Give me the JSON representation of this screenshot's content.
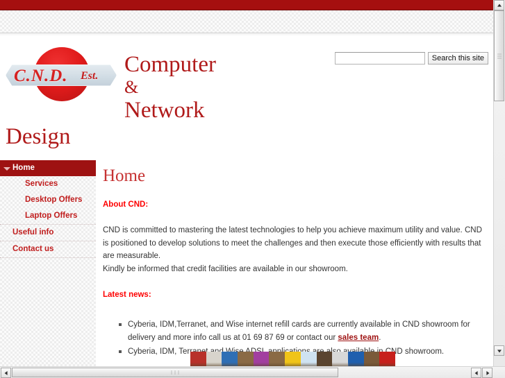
{
  "browser": {
    "vertical_scrollbar": {
      "up_arrow": "▲",
      "down_arrow": "▼"
    },
    "horizontal_scrollbar": {
      "left_arrow": "◄",
      "right_arrow": "►"
    }
  },
  "header": {
    "logo": {
      "badge_text": "C.N.D.",
      "badge_suffix": "Est.",
      "circle_color": "#e01b1b",
      "plate_color": "#d2dde5"
    },
    "wordmark": {
      "line1": "Computer",
      "line2": "&",
      "line3": "Network",
      "line4": "Design",
      "color": "#b01a1a"
    },
    "search": {
      "value": "",
      "placeholder": "",
      "button_label": "Search this site"
    }
  },
  "sidebar": {
    "items": [
      {
        "label": "Home",
        "level": "top",
        "active": true,
        "caret": "chevron-down-icon"
      },
      {
        "label": "Services",
        "level": "sub",
        "active": false
      },
      {
        "label": "Desktop Offers",
        "level": "sub",
        "active": false
      },
      {
        "label": "Laptop Offers",
        "level": "sub",
        "active": false
      },
      {
        "label": "Useful info",
        "level": "plain",
        "active": false
      },
      {
        "label": "Contact us",
        "level": "plain",
        "active": false
      }
    ],
    "active_color": "#9e1212",
    "link_color": "#c01d1d"
  },
  "main": {
    "title": "Home",
    "about_heading": "About CND:",
    "about_paragraph": "CND is committed to mastering the latest technologies to help you achieve maximum utility and value. CND is positioned to develop solutions to meet the challenges and then execute those efficiently with results that are measurable.\nKindly be informed that credit facilities are available in our showroom.",
    "about_line1": "CND is committed to mastering the latest technologies to help you achieve maximum utility and value.",
    "about_line2": "CND is positioned to develop solutions to meet the challenges and then execute those efficiently with results that are measurable.",
    "about_line3": "Kindly be informed that credit facilities are available in our showroom.",
    "news_heading": "Latest news:",
    "news_items": [
      {
        "text_before": "Cyberia, IDM,Terranet, and Wise internet refill cards are currently available in CND showroom for delivery and more info call us at 01 69 87 69 or contact our ",
        "link_label": "sales team",
        "text_after": "."
      },
      {
        "text_before": "Cyberia, IDM, Terranet and Wise ADSL applications are also available in CND showroom.",
        "link_label": "",
        "text_after": ""
      }
    ],
    "link_color": "#9e1212",
    "heading_color": "#fe0000"
  },
  "photo_strip": {
    "alt": "internet refill cards on shelf",
    "colors": [
      "#b8312a",
      "#d8d4cc",
      "#2f6fb5",
      "#8a6a45",
      "#a23fa0",
      "#8a6a45",
      "#f0c419",
      "#cfe3f2",
      "#5a4430",
      "#d8d8d8",
      "#1f5fae",
      "#7a5a3a",
      "#c7201c"
    ]
  }
}
